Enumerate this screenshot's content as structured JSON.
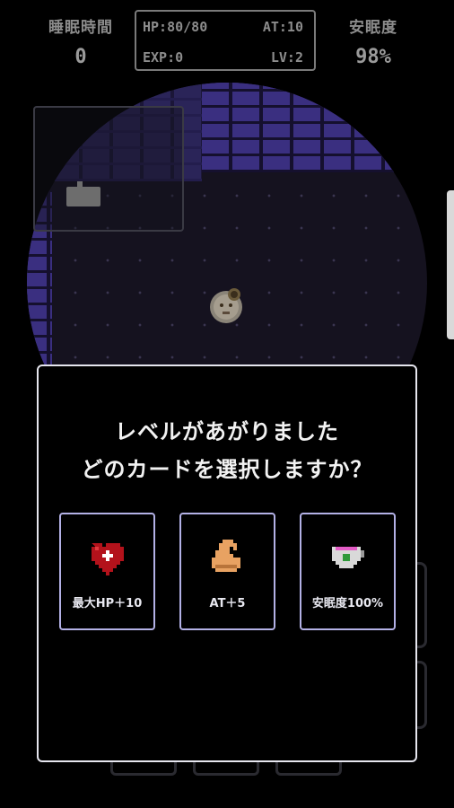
{
  "hud": {
    "sleep_label": "睡眠時間",
    "sleep_value": "0",
    "comfort_label": "安眠度",
    "comfort_value": "98%",
    "hp": "HP:80/80",
    "at": "AT:10",
    "exp": "EXP:0",
    "lv": "LV:2"
  },
  "dialog": {
    "line1": "レベルがあがりました",
    "line2": "どのカードを選択しますか？"
  },
  "cards": [
    {
      "label": "最大HP＋10",
      "icon": "heart-plus-icon"
    },
    {
      "label": "AT＋5",
      "icon": "flexed-arm-icon"
    },
    {
      "label": "安眠度100%",
      "icon": "teacup-icon"
    }
  ],
  "colors": {
    "dialog_border": "#e6e6ef",
    "card_border": "#b3b1e6",
    "wall": "#3a2f80",
    "floor": "#15121f"
  }
}
